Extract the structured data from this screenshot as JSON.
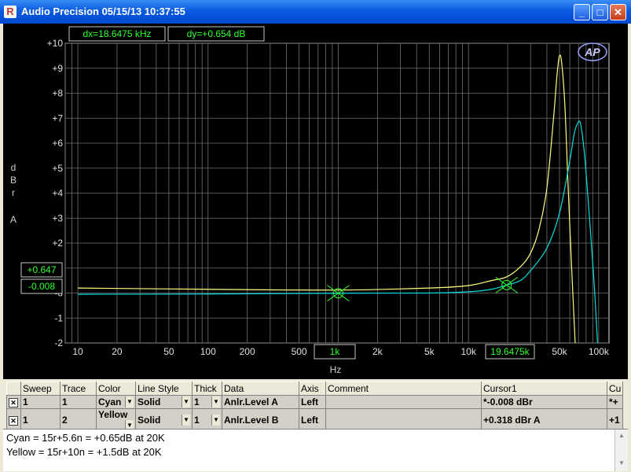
{
  "window": {
    "title": "Audio Precision  05/15/13 10:37:55",
    "app_icon": "ap-app-icon",
    "buttons": {
      "minimize": "_",
      "maximize": "□",
      "close": "✕"
    }
  },
  "graph": {
    "readout_dx": "dx=18.6475 kHz",
    "readout_dy": "dy=+0.654  dB",
    "cursor_left_top": "+0.647",
    "cursor_left_bottom": "-0.008",
    "cursor_x_1": "1k",
    "cursor_x_2": "19.6475k",
    "logo": "AP",
    "y_unit_letters": [
      "d",
      "B",
      "r"
    ],
    "y_axis_name": "A",
    "x_unit": "Hz"
  },
  "chart_data": {
    "type": "line",
    "xscale": "log",
    "xlim": [
      8,
      120000
    ],
    "ylim": [
      -2,
      10
    ],
    "grid": true,
    "x_ticks": [
      {
        "v": 10,
        "label": "10"
      },
      {
        "v": 20,
        "label": "20"
      },
      {
        "v": 50,
        "label": "50"
      },
      {
        "v": 100,
        "label": "100"
      },
      {
        "v": 200,
        "label": "200"
      },
      {
        "v": 500,
        "label": "500"
      },
      {
        "v": 1000,
        "label": "1k"
      },
      {
        "v": 2000,
        "label": "2k"
      },
      {
        "v": 5000,
        "label": "5k"
      },
      {
        "v": 10000,
        "label": "10k"
      },
      {
        "v": 20000,
        "label": "20k"
      },
      {
        "v": 50000,
        "label": "50k"
      },
      {
        "v": 100000,
        "label": "100k"
      }
    ],
    "y_ticks": [
      {
        "v": 10,
        "label": "+10"
      },
      {
        "v": 9,
        "label": "+9"
      },
      {
        "v": 8,
        "label": "+8"
      },
      {
        "v": 7,
        "label": "+7"
      },
      {
        "v": 6,
        "label": "+6"
      },
      {
        "v": 5,
        "label": "+5"
      },
      {
        "v": 4,
        "label": "+4"
      },
      {
        "v": 3,
        "label": "+3"
      },
      {
        "v": 2,
        "label": "+2"
      },
      {
        "v": 1,
        "label": "+1"
      },
      {
        "v": 0,
        "label": "-0"
      },
      {
        "v": -1,
        "label": "-1"
      },
      {
        "v": -2,
        "label": "-2"
      }
    ],
    "series": [
      {
        "color": "#ffff80",
        "x": [
          10,
          100,
          1000,
          5000,
          10000,
          15000,
          19647.5,
          25000,
          30000,
          35000,
          40000,
          45000,
          48000,
          50000,
          52000,
          55000,
          58000,
          62000,
          66000
        ],
        "y": [
          0.2,
          0.15,
          0.12,
          0.2,
          0.3,
          0.5,
          0.647,
          1.05,
          1.6,
          2.6,
          4.2,
          7.0,
          8.8,
          9.5,
          9.2,
          7.5,
          4.5,
          1.0,
          -2.0
        ]
      },
      {
        "color": "#00e0e0",
        "x": [
          10,
          100,
          1000,
          5000,
          10000,
          15000,
          19647.5,
          25000,
          30000,
          40000,
          50000,
          60000,
          65000,
          70000,
          73000,
          78000,
          85000,
          92000,
          98000
        ],
        "y": [
          -0.05,
          -0.04,
          -0.008,
          0.0,
          0.05,
          0.15,
          0.318,
          0.5,
          0.9,
          1.8,
          3.2,
          5.3,
          6.4,
          6.85,
          6.7,
          5.5,
          3.0,
          0.5,
          -2.0
        ]
      }
    ],
    "cursors": [
      {
        "x": 1000,
        "y": -0.008,
        "color": "#30ff30"
      },
      {
        "x": 19647.5,
        "y": 0.318,
        "color": "#30ff30"
      }
    ]
  },
  "table": {
    "headers": [
      "Sweep",
      "Trace",
      "Color",
      "Line Style",
      "Thick",
      "Data",
      "Axis",
      "Comment",
      "Cursor1",
      "Cu"
    ],
    "rows": [
      {
        "checked": "✕",
        "sweep": "1",
        "trace": "1",
        "color": "Cyan",
        "line_style": "Solid",
        "thick": "1",
        "data": "Anlr.Level A",
        "axis": "Left",
        "comment": "",
        "cursor1": "*-0.008  dBr",
        "cu": "*+"
      },
      {
        "checked": "✕",
        "sweep": "1",
        "trace": "2",
        "color": "Yellow",
        "line_style": "Solid",
        "thick": "1",
        "data": "Anlr.Level B",
        "axis": "Left",
        "comment": "",
        "cursor1": "+0.318  dBr A",
        "cu": "+1"
      }
    ]
  },
  "notes": {
    "line1": "Cyan = 15r+5.6n = +0.65dB at 20K",
    "line2": "Yellow = 15r+10n = +1.5dB at 20K"
  }
}
